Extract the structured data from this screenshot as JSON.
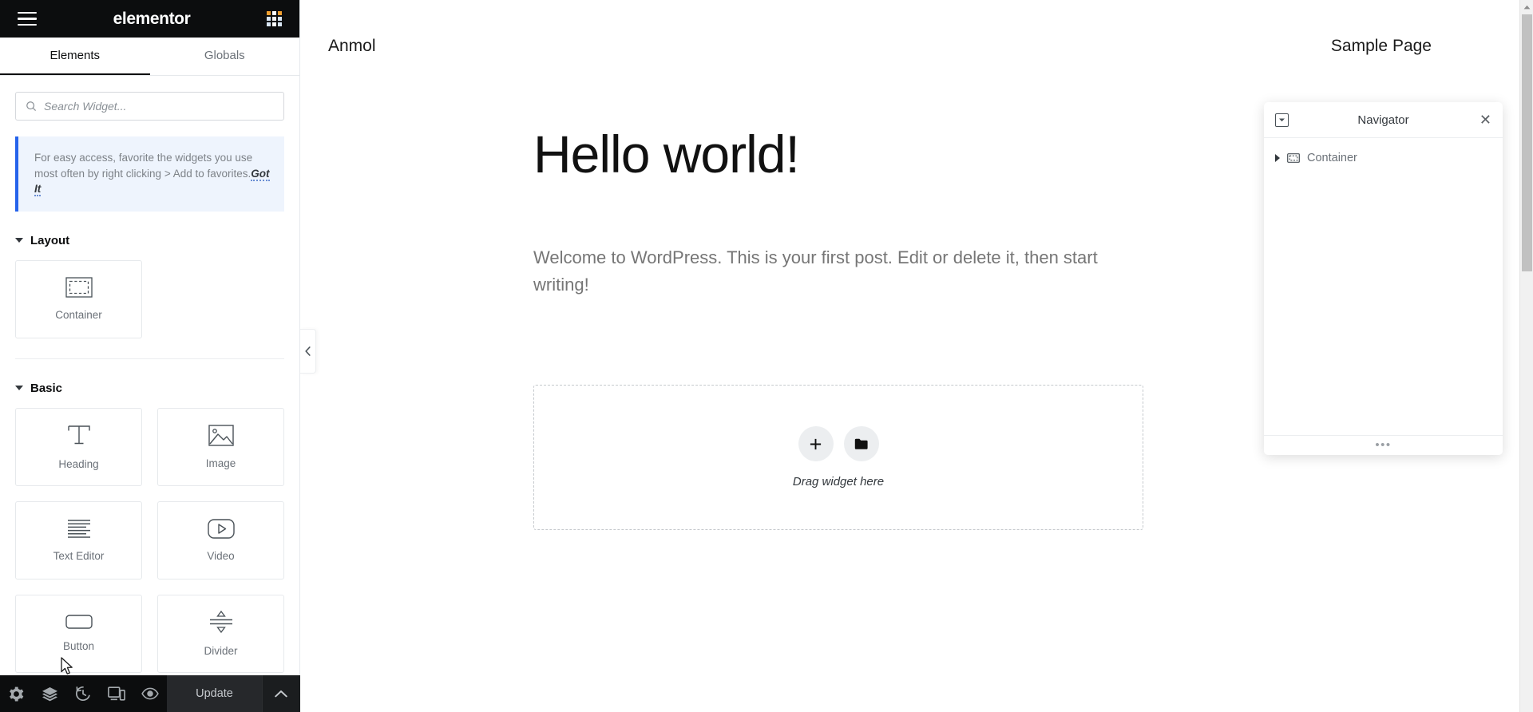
{
  "panel": {
    "brand": "elementor",
    "menu_icon": "hamburger-icon",
    "apps_icon": "grid-apps-icon",
    "tabs": [
      {
        "label": "Elements",
        "active": true
      },
      {
        "label": "Globals",
        "active": false
      }
    ],
    "search": {
      "placeholder": "Search Widget...",
      "value": "",
      "icon": "search-icon"
    },
    "notice": {
      "text": "For easy access, favorite the widgets you use most often by right clicking > Add to favorites.",
      "action": "Got It",
      "accent": "#2563eb",
      "background": "#eef4fd"
    },
    "categories": [
      {
        "title": "Layout",
        "widgets": [
          {
            "label": "Container",
            "icon": "container-icon"
          }
        ]
      },
      {
        "title": "Basic",
        "widgets": [
          {
            "label": "Heading",
            "icon": "heading-t-icon"
          },
          {
            "label": "Image",
            "icon": "image-icon"
          },
          {
            "label": "Text Editor",
            "icon": "text-editor-icon"
          },
          {
            "label": "Video",
            "icon": "video-play-icon"
          },
          {
            "label": "Button",
            "icon": "button-icon"
          },
          {
            "label": "Divider",
            "icon": "divider-icon"
          }
        ]
      }
    ],
    "footer": {
      "buttons": [
        {
          "name": "settings-gear-icon"
        },
        {
          "name": "layers-navigator-icon"
        },
        {
          "name": "history-clock-icon"
        },
        {
          "name": "responsive-devices-icon"
        },
        {
          "name": "preview-eye-icon"
        }
      ],
      "update_label": "Update",
      "chevron_icon": "chevron-up-icon"
    },
    "collapse_icon": "chevron-left-icon"
  },
  "canvas": {
    "site_title": "Anmol",
    "nav_link": "Sample Page",
    "post": {
      "heading": "Hello world!",
      "body": "Welcome to WordPress. This is your first post. Edit or delete it, then start writing!"
    },
    "dropzone": {
      "add_icon": "plus-icon",
      "folder_icon": "folder-icon",
      "label": "Drag widget here"
    }
  },
  "navigator": {
    "title": "Navigator",
    "toggle_icon": "collapse-all-icon",
    "close_icon": "close-x-icon",
    "items": [
      {
        "label": "Container",
        "icon": "container-icon",
        "expandable": true
      }
    ],
    "resize_handle": "•••"
  },
  "scrollbar": {
    "up_arrow_icon": "scroll-up-arrow-icon"
  },
  "colors": {
    "panel_header_bg": "#0c0d0e",
    "accent_blue": "#2563eb",
    "update_bg": "#26282b"
  }
}
